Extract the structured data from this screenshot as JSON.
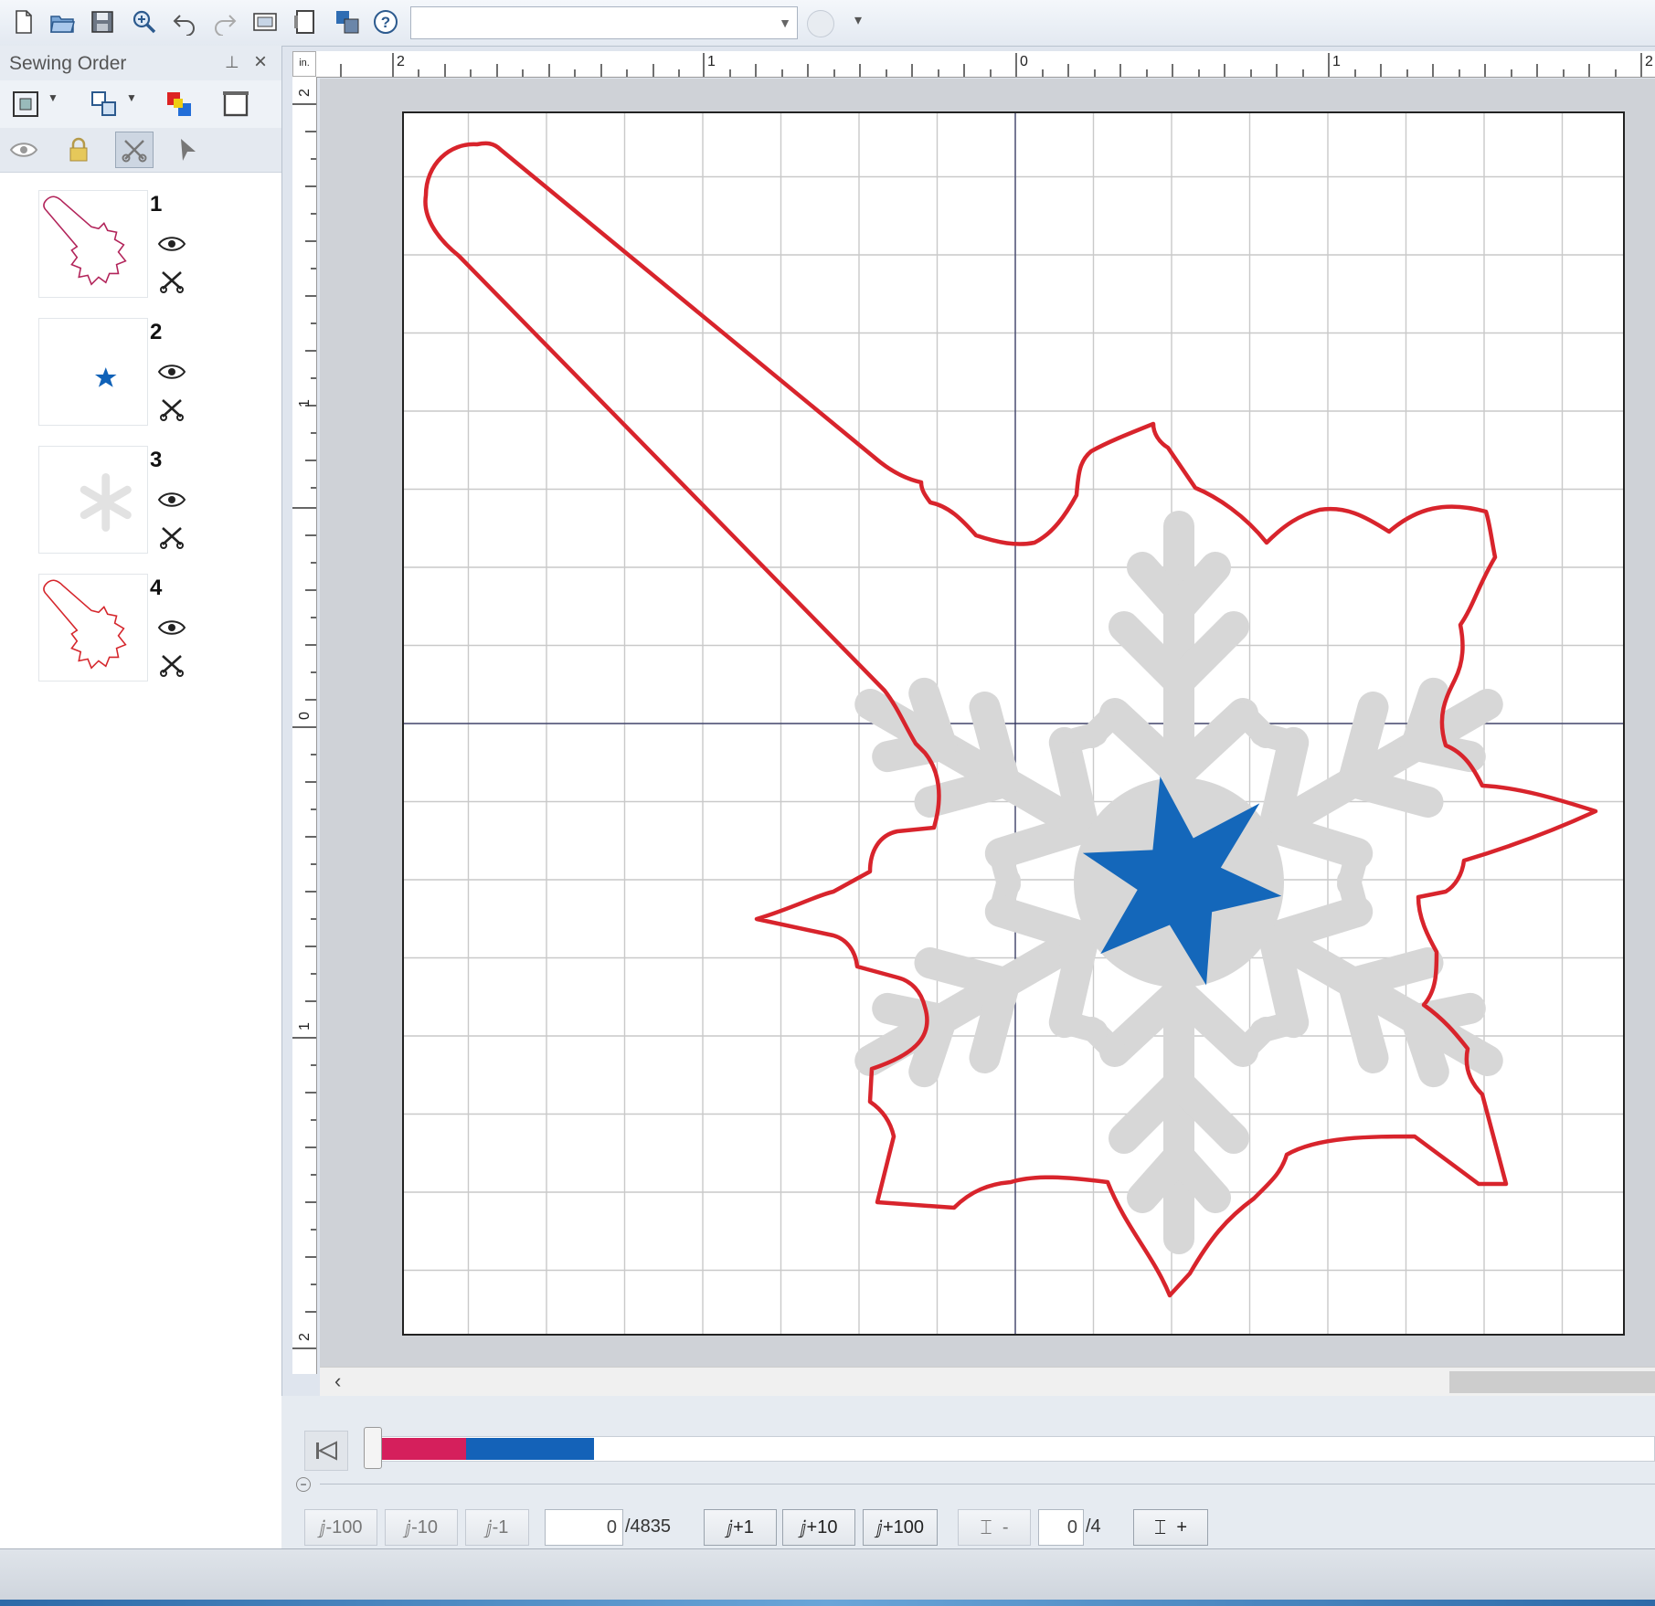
{
  "toolbar": {
    "buttons": [
      "new-file-icon",
      "open-folder-icon",
      "save-icon",
      "zoom-in-icon",
      "undo-icon",
      "redo-icon",
      "preview-icon",
      "hoop-icon",
      "color-icon",
      "help-icon"
    ],
    "combo_value": ""
  },
  "panel": {
    "title": "Sewing Order",
    "items": [
      {
        "num": "1",
        "color": "#b2245a"
      },
      {
        "num": "2",
        "color": "#1062b8"
      },
      {
        "num": "3",
        "color": "#e2e2e2"
      },
      {
        "num": "4",
        "color": "#d5262c"
      }
    ]
  },
  "rulers": {
    "unit": "in.",
    "h_labels": [
      "2",
      "1",
      "0",
      "1",
      "2"
    ],
    "v_labels": [
      "2",
      "1",
      "0",
      "1",
      "2"
    ]
  },
  "simulator": {
    "buttons": {
      "m100": "-100",
      "m10": "-10",
      "m1": "-1",
      "p1": "+1",
      "p10": "+10",
      "p100": "+100",
      "minus": "-",
      "plus": "+"
    },
    "stitch_value": "0",
    "stitch_total": "/4835",
    "color_value": "0",
    "color_total": "/4",
    "progress_colors": [
      "#d51f5c",
      "#1462b8"
    ]
  },
  "colors": {
    "outline": "#d8242c",
    "star": "#1467ba",
    "snowflake": "#d7d7d7",
    "grid": "#c9c9c9"
  }
}
